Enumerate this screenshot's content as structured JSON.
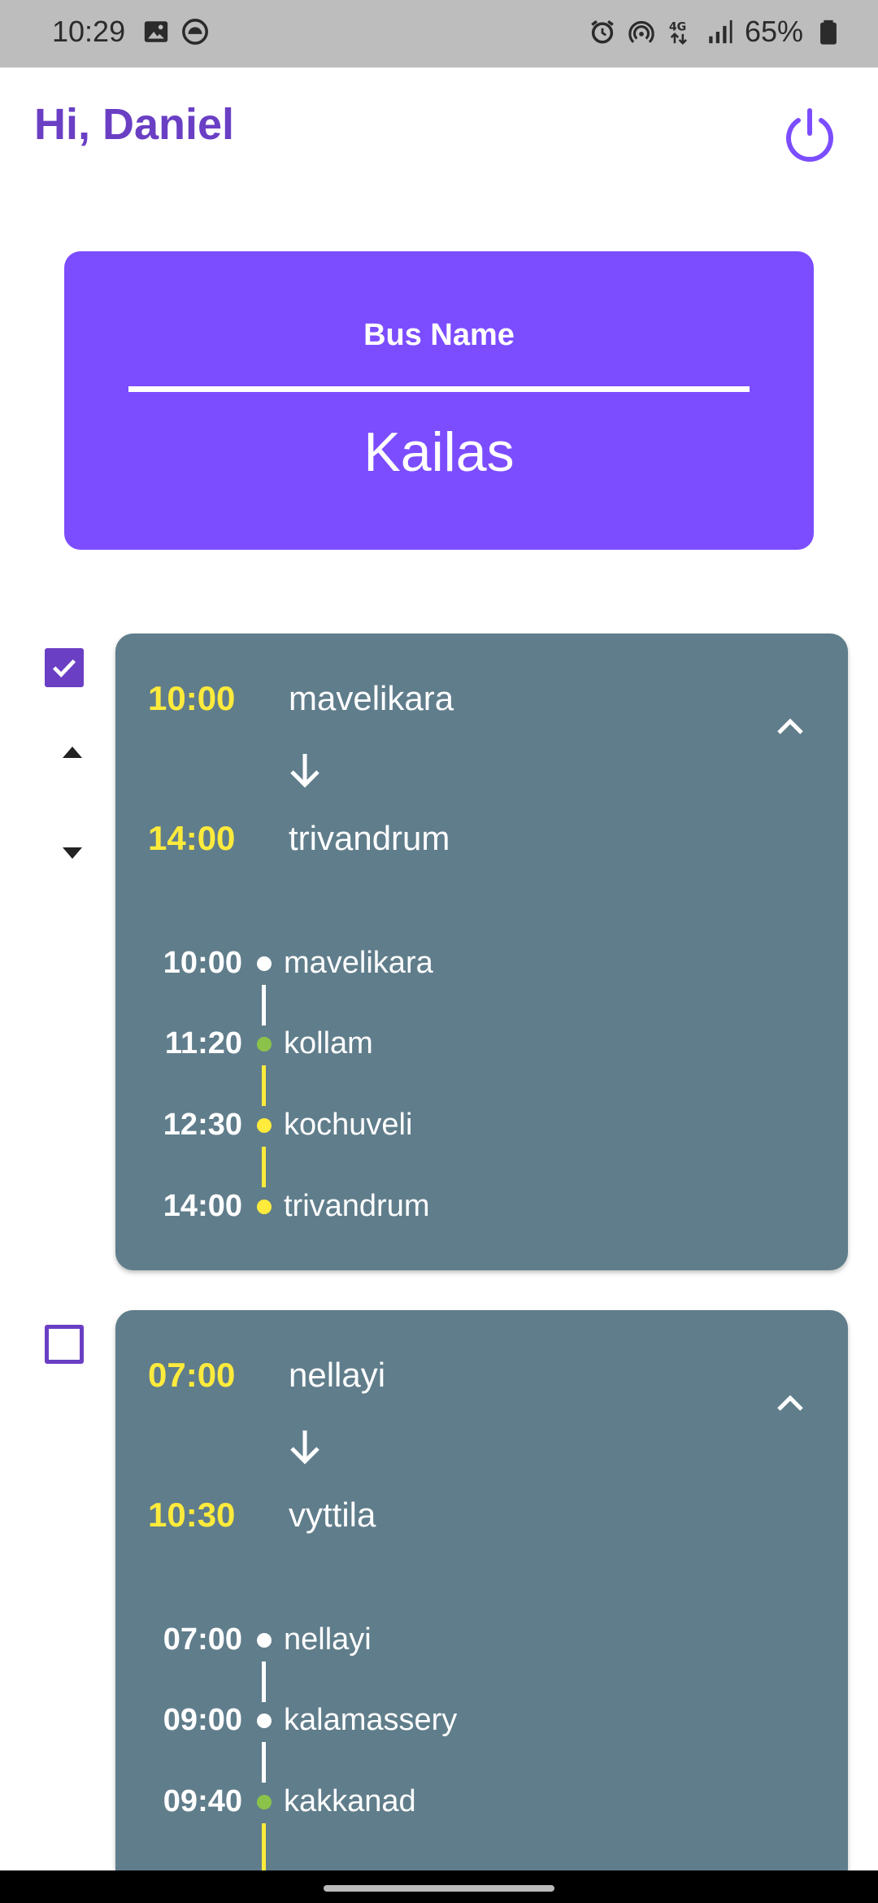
{
  "status_bar": {
    "time": "10:29",
    "battery_percent": "65%",
    "left_icons": [
      "image-icon",
      "cloud-sync-icon"
    ],
    "right_icons": [
      "alarm-icon",
      "hotspot-icon",
      "network-4g-icon",
      "signal-icon",
      "battery-icon"
    ]
  },
  "header": {
    "greeting": "Hi, Daniel",
    "power_icon": "power-icon"
  },
  "bus_card": {
    "label": "Bus Name",
    "name": "Kailas"
  },
  "colors": {
    "accent": "#7c4dff",
    "greeting": "#6a3fc4",
    "card": "#607d8b",
    "time_highlight": "#ffeb3b",
    "dot_white": "#ffffff",
    "dot_green": "#8bc34a",
    "dot_yellow": "#ffeb3b"
  },
  "routes": [
    {
      "checked": true,
      "start_time": "10:00",
      "start_place": "mavelikara",
      "end_time": "14:00",
      "end_place": "trivandrum",
      "stops": [
        {
          "time": "10:00",
          "place": "mavelikara",
          "dot": "white"
        },
        {
          "time": "11:20",
          "place": "kollam",
          "dot": "green"
        },
        {
          "time": "12:30",
          "place": "kochuveli",
          "dot": "yellow"
        },
        {
          "time": "14:00",
          "place": "trivandrum",
          "dot": "yellow"
        }
      ]
    },
    {
      "checked": false,
      "start_time": "07:00",
      "start_place": "nellayi",
      "end_time": "10:30",
      "end_place": "vyttila",
      "stops": [
        {
          "time": "07:00",
          "place": "nellayi",
          "dot": "white"
        },
        {
          "time": "09:00",
          "place": "kalamassery",
          "dot": "white"
        },
        {
          "time": "09:40",
          "place": "kakkanad",
          "dot": "green"
        }
      ]
    }
  ]
}
